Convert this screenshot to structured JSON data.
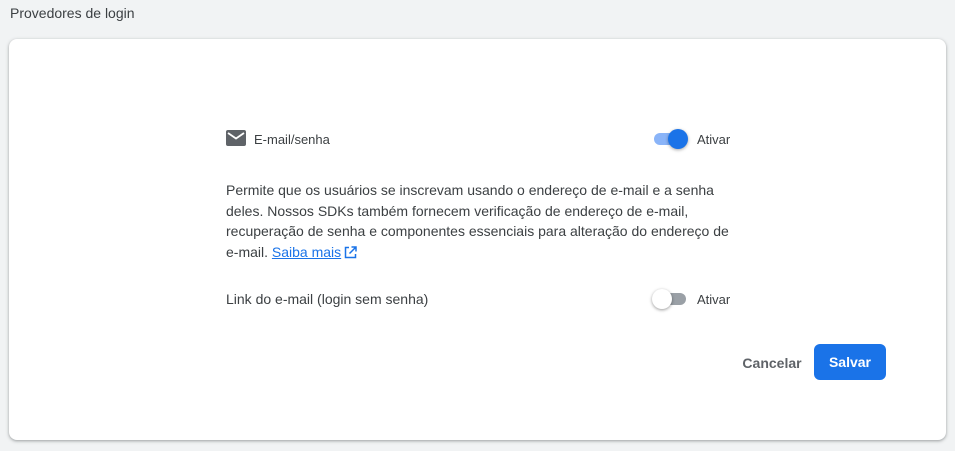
{
  "section": {
    "title": "Provedores de login"
  },
  "provider": {
    "icon": "mail-icon",
    "name": "E-mail/senha",
    "enabled": true,
    "toggle_label": "Ativar"
  },
  "description": {
    "text": "Permite que os usuários se inscrevam usando o endereço de e-mail e a senha deles. Nossos SDKs também fornecem verificação de endereço de e-mail, recuperação de senha e componentes essenciais para alteração do endereço de e-mail. ",
    "learn_more": "Saiba mais",
    "learn_more_icon": "open-in-new-icon"
  },
  "email_link": {
    "label": "Link do e-mail (login sem senha)",
    "enabled": false,
    "toggle_label": "Ativar"
  },
  "actions": {
    "cancel": "Cancelar",
    "save": "Salvar"
  },
  "colors": {
    "accent": "#1a73e8",
    "accent_light": "#8ab4f8",
    "background": "#f1f3f4",
    "text": "#3c4043"
  }
}
